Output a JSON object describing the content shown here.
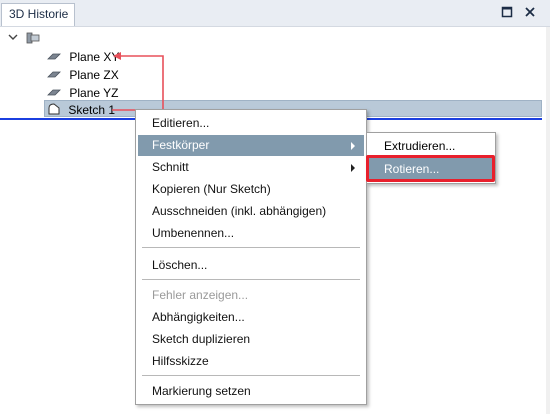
{
  "panel": {
    "tab_title": "3D Historie",
    "buttons": [
      "maximize-icon",
      "close-icon"
    ]
  },
  "tree": {
    "root_icon": "part-icon",
    "items": [
      {
        "label": "Plane XY",
        "icon": "plane-icon"
      },
      {
        "label": "Plane ZX",
        "icon": "plane-icon"
      },
      {
        "label": "Plane YZ",
        "icon": "plane-icon"
      },
      {
        "label": "Sketch 1",
        "icon": "sketch-icon",
        "selected": true
      }
    ]
  },
  "context_menu": {
    "items": [
      {
        "label": "Editieren..."
      },
      {
        "label": "Festkörper",
        "submenu": true,
        "highlighted": true
      },
      {
        "label": "Schnitt",
        "submenu": true
      },
      {
        "label": "Kopieren (Nur Sketch)"
      },
      {
        "label": "Ausschneiden (inkl. abhängigen)"
      },
      {
        "label": "Umbenennen..."
      },
      {
        "label": "Löschen..."
      },
      {
        "label": "Fehler anzeigen...",
        "disabled": true
      },
      {
        "label": "Abhängigkeiten..."
      },
      {
        "label": "Sketch duplizieren"
      },
      {
        "label": "Hilfsskizze"
      },
      {
        "label": "Markierung setzen"
      }
    ]
  },
  "submenu": {
    "items": [
      {
        "label": "Extrudieren..."
      },
      {
        "label": "Rotieren...",
        "highlighted": true
      }
    ]
  },
  "annotation_colors": {
    "arrow": "#e8505a",
    "box": "#e8202c"
  }
}
